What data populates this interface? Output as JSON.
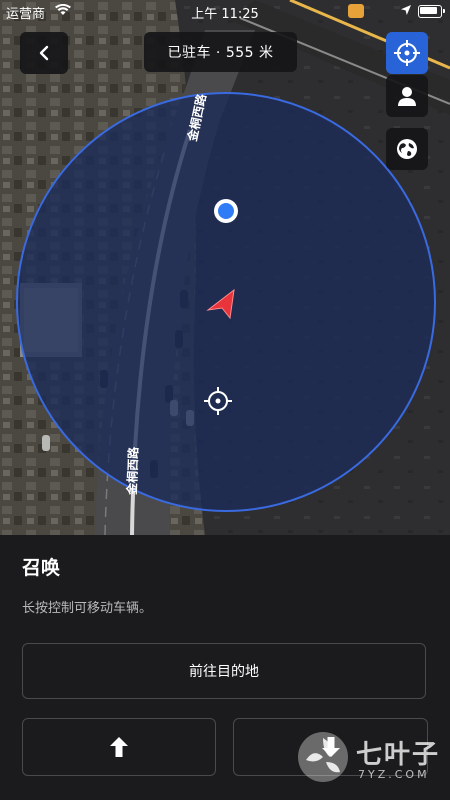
{
  "status_bar": {
    "carrier": "运营商",
    "time": "上午 11:25"
  },
  "header": {
    "title": "已驻车 · 555 米"
  },
  "map": {
    "road_label_top": "金桐西路",
    "road_label_bottom": "金桐西路"
  },
  "panel": {
    "title": "召唤",
    "description": "长按控制可移动车辆。",
    "destination_button": "前往目的地"
  },
  "watermark": {
    "text": "七叶子",
    "sub": "7YZ.COM"
  },
  "colors": {
    "accent": "#2864d8",
    "car_arrow": "#e8343a",
    "circle_fill": "#1b2b5a",
    "panel_bg": "#1b1b1d"
  }
}
